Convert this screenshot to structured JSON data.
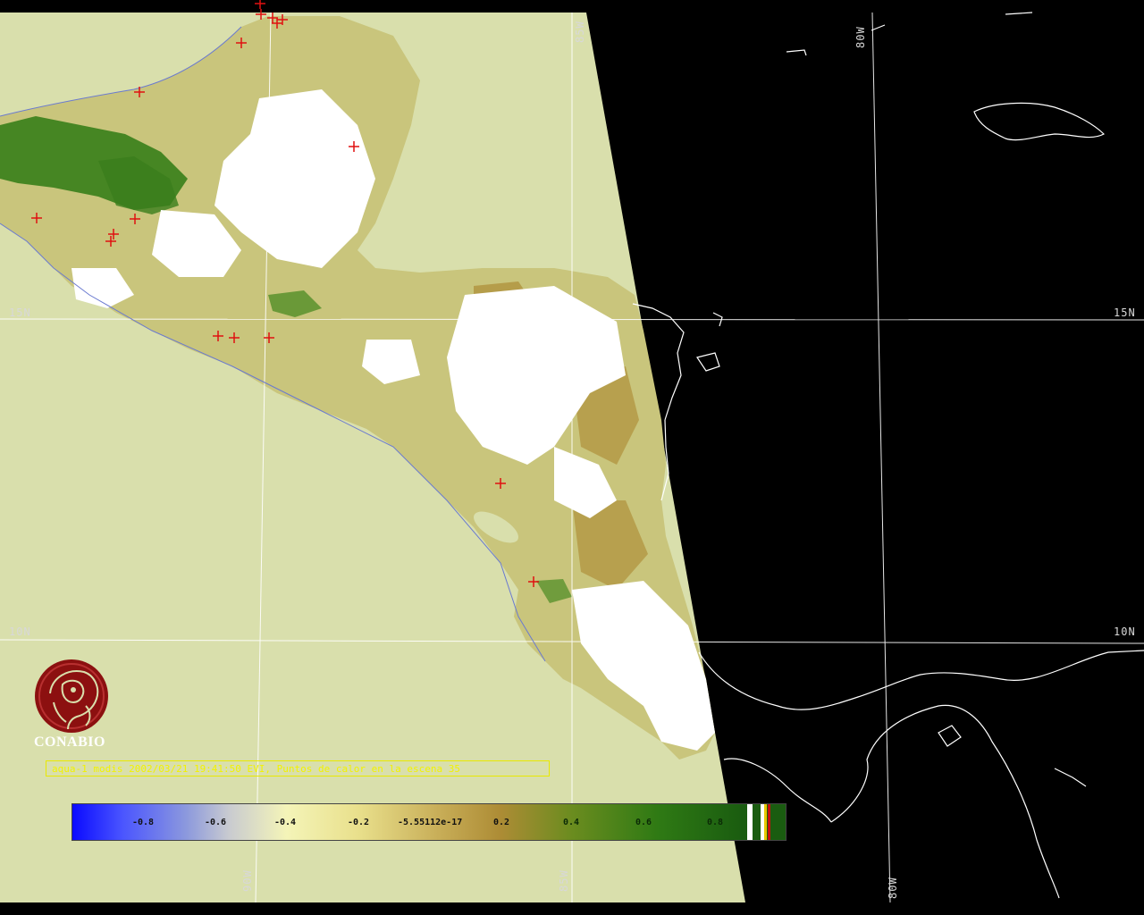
{
  "map": {
    "gridlines": {
      "lat_labels": [
        "15N",
        "15N",
        "10N",
        "10N"
      ],
      "lon_labels": [
        "85W",
        "80W",
        "90W",
        "85W",
        "80W"
      ]
    },
    "colors": {
      "ocean_data_region": "#d9dfac",
      "no_data_region": "#000000",
      "cloud_white": "#ffffff",
      "coastline": "#ffffff",
      "grid": "#ffffff",
      "fire_marker": "#e01010"
    }
  },
  "caption": {
    "text": "aqua-1 modis 2002/03/21 19:41:50 EVI, Puntos de calor en la escena 35"
  },
  "colorbar": {
    "labels": [
      "-0.8",
      "-0.6",
      "-0.4",
      "-0.2",
      "-5.55112e-17",
      "0.2",
      "0.4",
      "0.6",
      "0.8"
    ],
    "end_swatches": [
      "#ffffff",
      "#1a5c10",
      "#ffffff",
      "#e8c800",
      "#c81010"
    ]
  },
  "logo": {
    "name": "CONABIO",
    "icon": "conabio-macaw-logo-icon"
  }
}
